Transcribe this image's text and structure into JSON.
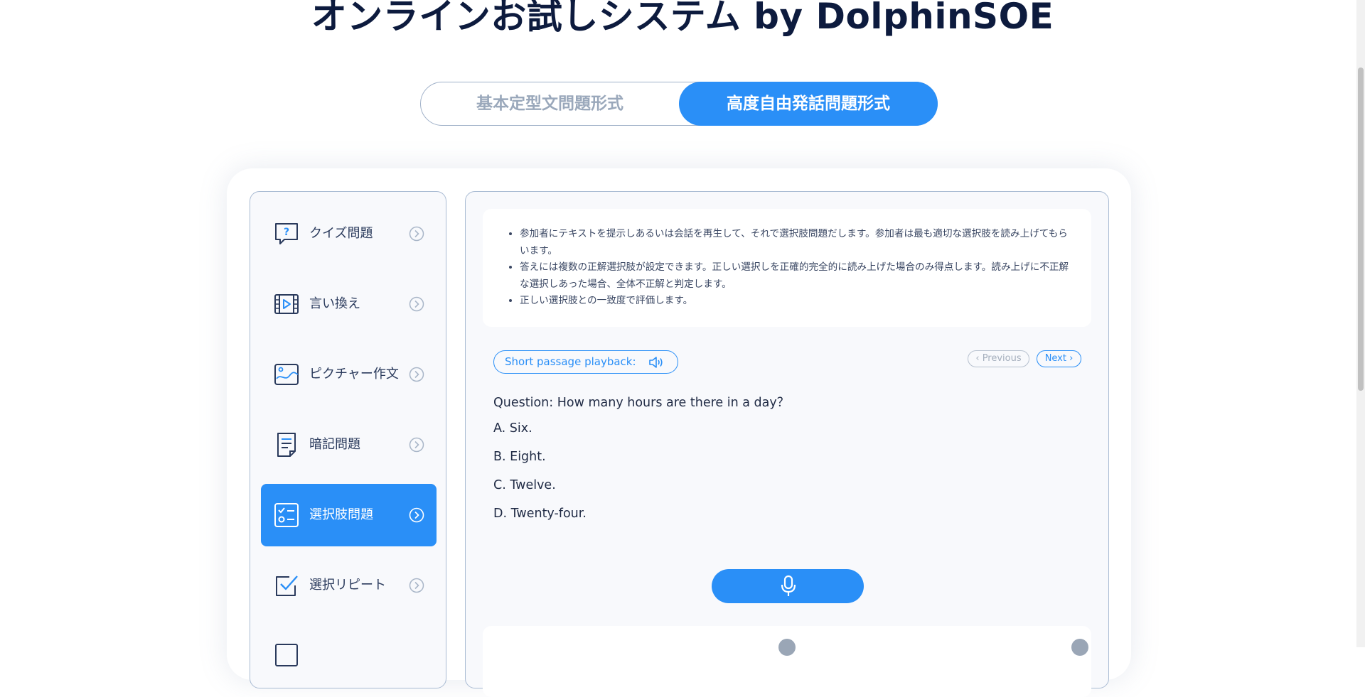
{
  "page": {
    "title": "オンラインお試しシステム by DolphinSOE"
  },
  "mode_tabs": [
    {
      "label": "基本定型文問題形式",
      "active": false
    },
    {
      "label": "高度自由発話問題形式",
      "active": true
    }
  ],
  "sidebar": {
    "items": [
      {
        "label": "クイズ問題",
        "icon": "quiz-bubble-icon",
        "active": false
      },
      {
        "label": "言い換え",
        "icon": "video-play-icon",
        "active": false
      },
      {
        "label": "ピクチャー作文",
        "icon": "picture-icon",
        "active": false
      },
      {
        "label": "暗記問題",
        "icon": "document-icon",
        "active": false
      },
      {
        "label": "選択肢問題",
        "icon": "checklist-icon",
        "active": true
      },
      {
        "label": "選択リピート",
        "icon": "check-repeat-icon",
        "active": false
      }
    ]
  },
  "description": {
    "bullets": [
      "参加者にテキストを提示しあるいは会話を再生して、それで選択肢問題だします。参加者は最も適切な選択肢を読み上げてもらいます。",
      "答えには複数の正解選択肢が設定できます。正しい選択しを正確的完全的に読み上げた場合のみ得点します。読み上げに不正解な選択しあった場合、全体不正解と判定します。",
      "正しい選択肢との一致度で評価します。"
    ]
  },
  "playback": {
    "label": "Short passage playback:",
    "icon": "speaker-icon"
  },
  "navigation": {
    "previous": "‹ Previous",
    "next": "Next ›"
  },
  "question": {
    "text": "Question:  How many hours are there in a day？",
    "options": [
      "A. Six.",
      "B. Eight.",
      "C. Twelve.",
      "D. Twenty-four."
    ]
  },
  "record": {
    "icon": "microphone-icon"
  },
  "colors": {
    "accent": "#2a8ff7",
    "title": "#0d1b3e",
    "inactive_text": "#9aa8bb",
    "border": "#a9bbd3"
  }
}
